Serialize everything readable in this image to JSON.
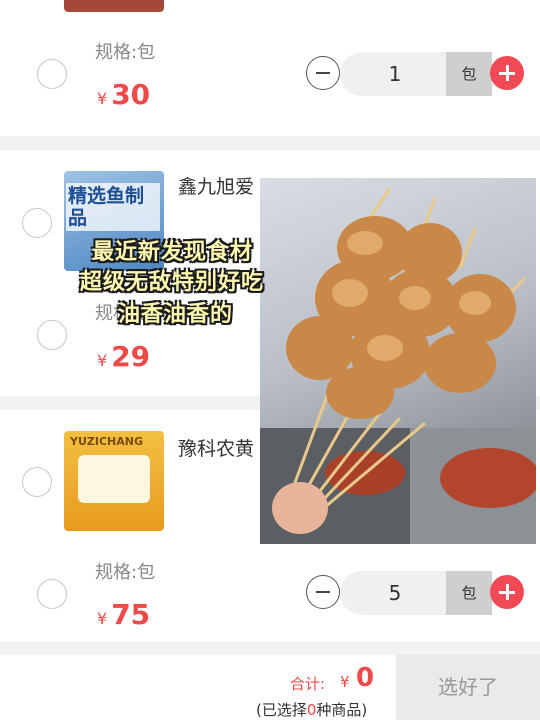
{
  "items": [
    {
      "spec": "规格:包",
      "currency": "¥",
      "price": "30",
      "qty": "1",
      "unit": "包"
    },
    {
      "title": "鑫九旭爱",
      "thumb_text": "精选鱼制品",
      "spec": "规格:包",
      "currency": "¥",
      "price": "29"
    },
    {
      "title": "豫科农黄",
      "thumb_text": "YUZICHANG",
      "spec": "规格:包",
      "currency": "¥",
      "price": "75",
      "qty": "5",
      "unit": "包"
    }
  ],
  "overlay": {
    "captions": [
      "最近新发现食材",
      "超级无敌特别好吃",
      "油香油香的"
    ]
  },
  "footer": {
    "total_label": "合计:",
    "currency": "¥",
    "total_value": "0",
    "selected_prefix": "(已选择",
    "selected_count": "0",
    "selected_suffix": "种商品)",
    "done_label": "选好了"
  },
  "colors": {
    "accent": "#ef4a4a",
    "plus_button": "#f24a55",
    "background": "#f2f2f2"
  }
}
